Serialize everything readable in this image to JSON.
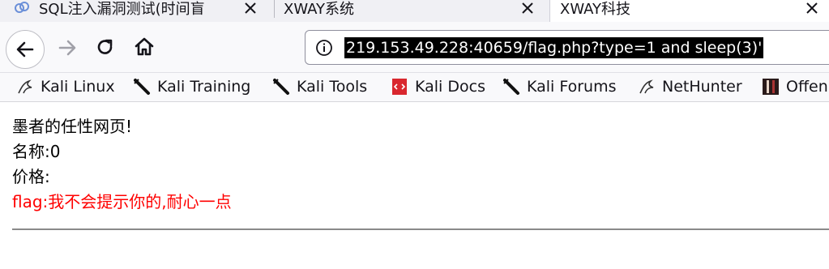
{
  "tabs": [
    {
      "title": "SQL注入漏洞测试(时间盲",
      "active": false
    },
    {
      "title": "XWAY系统",
      "active": false
    },
    {
      "title": "XWAY科技",
      "active": true
    }
  ],
  "urlbar": {
    "url": "219.153.49.228:40659/flag.php?type=1 and sleep(3)'"
  },
  "bookmarks": [
    {
      "label": "Kali Linux",
      "icon": "kali-dragon-icon"
    },
    {
      "label": "Kali Training",
      "icon": "kali-tool-icon"
    },
    {
      "label": "Kali Tools",
      "icon": "kali-tool-icon"
    },
    {
      "label": "Kali Docs",
      "icon": "kali-docs-icon"
    },
    {
      "label": "Kali Forums",
      "icon": "kali-tool-icon"
    },
    {
      "label": "NetHunter",
      "icon": "kali-dragon-icon"
    },
    {
      "label": "Offen",
      "icon": "offsec-icon"
    }
  ],
  "page": {
    "line1": "墨者的任性网页!",
    "line2": "名称:0",
    "line3": "价格:",
    "flag_line": "flag:我不会提示你的,耐心一点"
  },
  "colors": {
    "flag_text": "#ff0000",
    "url_highlight_bg": "#000000"
  }
}
